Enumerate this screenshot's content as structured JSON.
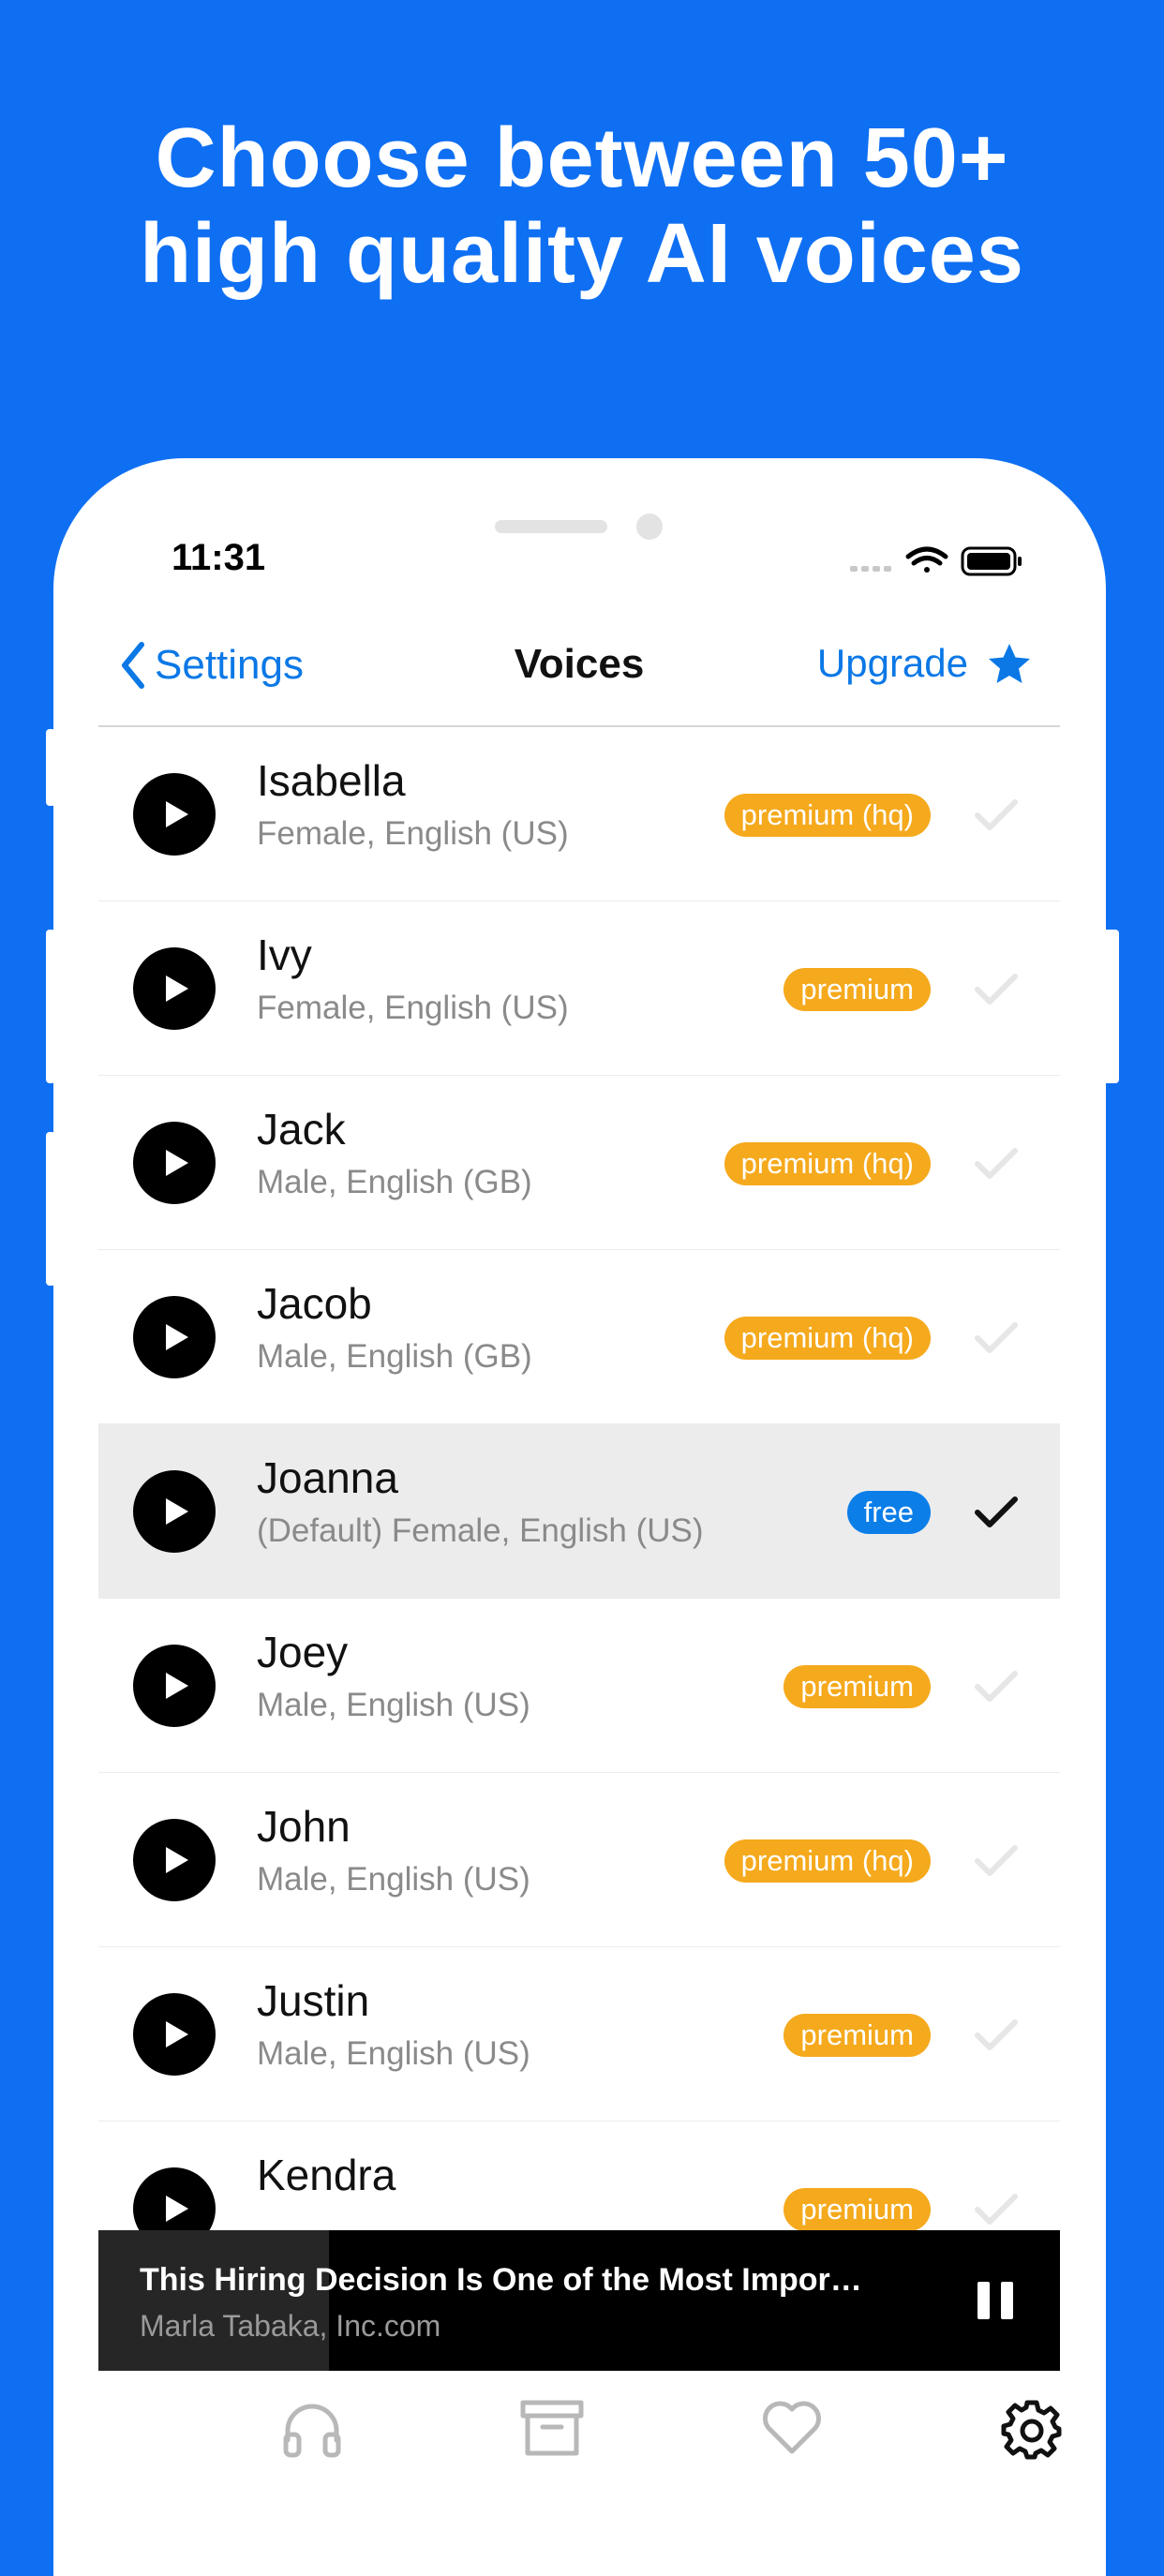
{
  "headline": {
    "line1": "Choose between 50+",
    "line2": "high quality AI voices"
  },
  "status_bar": {
    "time": "11:31"
  },
  "nav": {
    "back_label": "Settings",
    "title": "Voices",
    "upgrade_label": "Upgrade"
  },
  "voices": [
    {
      "name": "Isabella",
      "desc": "Female, English (US)",
      "badge": "premium (hq)",
      "selected": false
    },
    {
      "name": "Ivy",
      "desc": "Female, English (US)",
      "badge": "premium",
      "selected": false
    },
    {
      "name": "Jack",
      "desc": "Male, English (GB)",
      "badge": "premium (hq)",
      "selected": false
    },
    {
      "name": "Jacob",
      "desc": "Male, English (GB)",
      "badge": "premium (hq)",
      "selected": false
    },
    {
      "name": "Joanna",
      "desc": "(Default) Female, English (US)",
      "badge": "free",
      "selected": true
    },
    {
      "name": "Joey",
      "desc": "Male, English (US)",
      "badge": "premium",
      "selected": false
    },
    {
      "name": "John",
      "desc": "Male, English (US)",
      "badge": "premium (hq)",
      "selected": false
    },
    {
      "name": "Justin",
      "desc": "Male, English (US)",
      "badge": "premium",
      "selected": false
    },
    {
      "name": "Kendra",
      "desc": "",
      "badge": "premium",
      "selected": false
    }
  ],
  "player": {
    "title": "This Hiring Decision Is One of the Most Impor…",
    "subtitle": "Marla Tabaka, Inc.com",
    "progress_fraction": 0.24
  },
  "tabs": [
    {
      "icon": "headphones-icon",
      "active": false
    },
    {
      "icon": "archive-icon",
      "active": false
    },
    {
      "icon": "heart-icon",
      "active": false
    },
    {
      "icon": "gear-icon",
      "active": true
    }
  ],
  "colors": {
    "background": "#0f6ff2",
    "accent": "#0b78e6",
    "premium_badge": "#f5a91c",
    "free_badge": "#0b7ee8",
    "selected_row": "#ececec"
  }
}
